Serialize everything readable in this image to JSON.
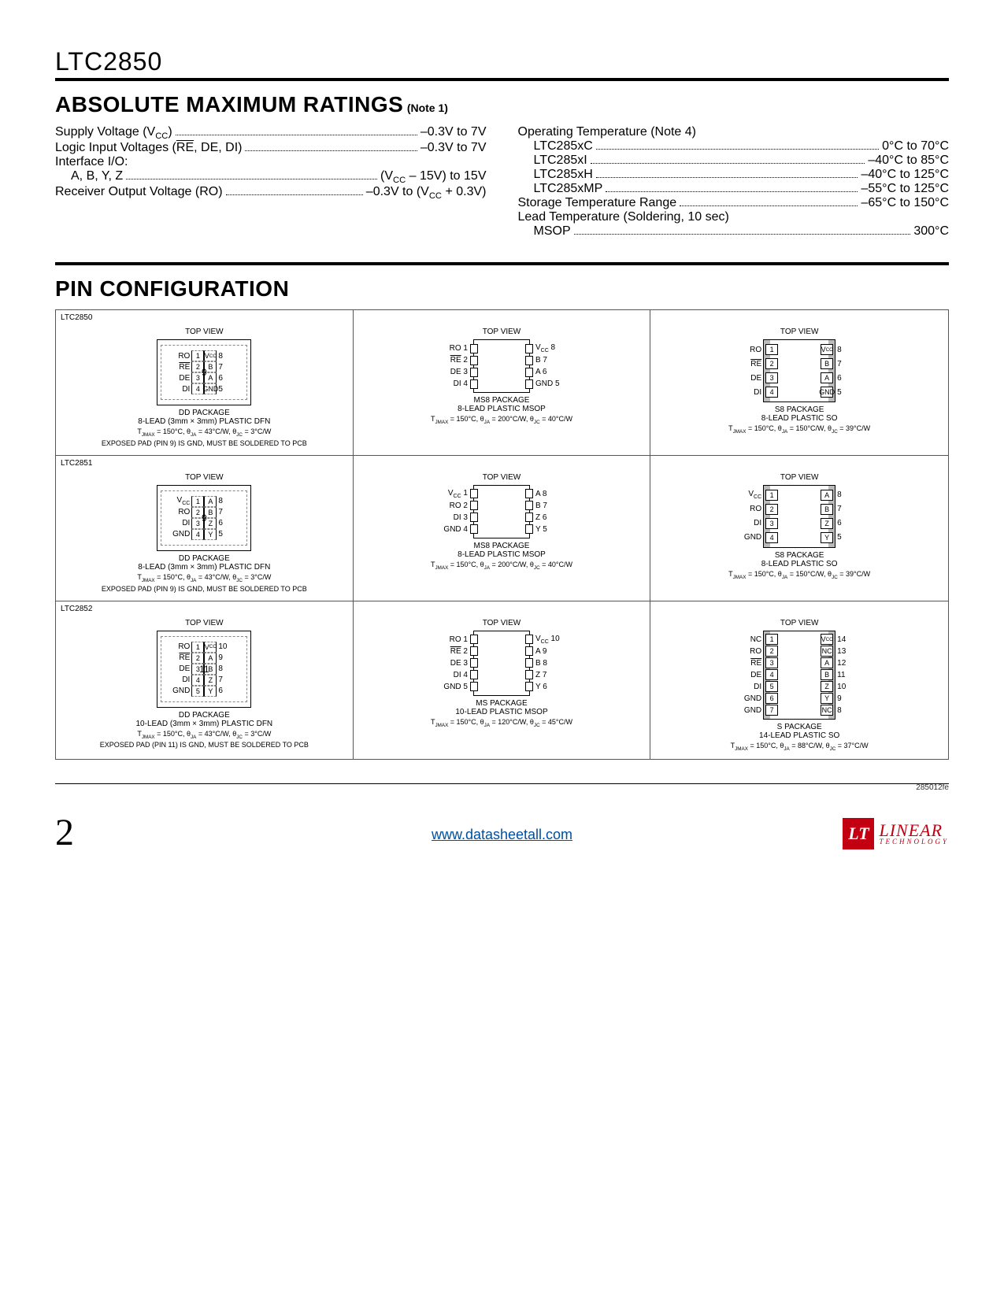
{
  "part_number": "LTC2850",
  "section1": {
    "title": "ABSOLUTE MAXIMUM RATINGS",
    "note": "(Note 1)"
  },
  "ratings_left": [
    {
      "label": "Supply Voltage (V<sub>CC</sub>)",
      "val": "–0.3V to 7V",
      "indent": 0
    },
    {
      "label": "Logic Input Voltages (<span class='overline'>RE</span>, DE, DI)",
      "val": "–0.3V to 7V",
      "indent": 0
    },
    {
      "label": "Interface I/O:",
      "val": "",
      "indent": 0,
      "nodots": true
    },
    {
      "label": "A, B, Y, Z",
      "val": "(V<sub>CC</sub> – 15V) to 15V",
      "indent": 1
    },
    {
      "label": "Receiver Output Voltage (RO)",
      "val": "–0.3V to (V<sub>CC</sub> + 0.3V)",
      "indent": 0
    }
  ],
  "ratings_right": [
    {
      "label": "Operating Temperature (Note 4)",
      "val": "",
      "indent": 0,
      "nodots": true
    },
    {
      "label": "LTC285xC",
      "val": "0°C to 70°C",
      "indent": 1
    },
    {
      "label": "LTC285xI",
      "val": "–40°C to 85°C",
      "indent": 1
    },
    {
      "label": "LTC285xH",
      "val": "–40°C to 125°C",
      "indent": 1
    },
    {
      "label": "LTC285xMP",
      "val": "–55°C to 125°C",
      "indent": 1
    },
    {
      "label": "Storage Temperature Range",
      "val": "–65°C to 150°C",
      "indent": 0
    },
    {
      "label": "Lead Temperature (Soldering, 10 sec)",
      "val": "",
      "indent": 0,
      "nodots": true
    },
    {
      "label": "MSOP",
      "val": "300°C",
      "indent": 1
    }
  ],
  "section2": {
    "title": "PIN CONFIGURATION"
  },
  "packages": [
    {
      "chip": "LTC2850",
      "cells": [
        {
          "type": "dfn",
          "center": "9",
          "left": [
            [
              "RO",
              "1"
            ],
            [
              "RE",
              "2",
              "ol"
            ],
            [
              "DE",
              "3"
            ],
            [
              "DI",
              "4"
            ]
          ],
          "right": [
            [
              "8",
              "V<sub>CC</sub>"
            ],
            [
              "7",
              "B"
            ],
            [
              "6",
              "A"
            ],
            [
              "5",
              "GND"
            ]
          ],
          "pkg": "DD PACKAGE",
          "sub": "8-LEAD (3mm × 3mm) PLASTIC DFN",
          "thermal": "T<sub>JMAX</sub> = 150°C, θ<sub>JA</sub> = 43°C/W, θ<sub>JC</sub> = 3°C/W",
          "note": "EXPOSED PAD (PIN 9) IS GND, MUST BE SOLDERED TO PCB"
        },
        {
          "type": "msop",
          "left": [
            [
              "RO",
              "1"
            ],
            [
              "RE",
              "2",
              "ol"
            ],
            [
              "DE",
              "3"
            ],
            [
              "DI",
              "4"
            ]
          ],
          "right": [
            [
              "8",
              "V<sub>CC</sub>"
            ],
            [
              "7",
              "B"
            ],
            [
              "6",
              "A"
            ],
            [
              "5",
              "GND"
            ]
          ],
          "pkg": "MS8 PACKAGE",
          "sub": "8-LEAD PLASTIC MSOP",
          "thermal": "T<sub>JMAX</sub> = 150°C, θ<sub>JA</sub> = 200°C/W, θ<sub>JC</sub> = 40°C/W"
        },
        {
          "type": "so",
          "left": [
            [
              "RO",
              "1"
            ],
            [
              "RE",
              "2",
              "ol"
            ],
            [
              "DE",
              "3"
            ],
            [
              "DI",
              "4"
            ]
          ],
          "right": [
            [
              "8",
              "V<sub>CC</sub>"
            ],
            [
              "7",
              "B"
            ],
            [
              "6",
              "A"
            ],
            [
              "5",
              "GND"
            ]
          ],
          "pkg": "S8 PACKAGE",
          "sub": "8-LEAD PLASTIC SO",
          "thermal": "T<sub>JMAX</sub> = 150°C, θ<sub>JA</sub> = 150°C/W, θ<sub>JC</sub> = 39°C/W"
        }
      ]
    },
    {
      "chip": "LTC2851",
      "cells": [
        {
          "type": "dfn",
          "center": "9",
          "left": [
            [
              "V<sub>CC</sub>",
              "1"
            ],
            [
              "RO",
              "2"
            ],
            [
              "DI",
              "3"
            ],
            [
              "GND",
              "4"
            ]
          ],
          "right": [
            [
              "8",
              "A"
            ],
            [
              "7",
              "B"
            ],
            [
              "6",
              "Z"
            ],
            [
              "5",
              "Y"
            ]
          ],
          "pkg": "DD PACKAGE",
          "sub": "8-LEAD (3mm × 3mm) PLASTIC DFN",
          "thermal": "T<sub>JMAX</sub> = 150°C, θ<sub>JA</sub> = 43°C/W, θ<sub>JC</sub> = 3°C/W",
          "note": "EXPOSED PAD (PIN 9) IS GND, MUST BE SOLDERED TO PCB"
        },
        {
          "type": "msop",
          "left": [
            [
              "V<sub>CC</sub>",
              "1"
            ],
            [
              "RO",
              "2"
            ],
            [
              "DI",
              "3"
            ],
            [
              "GND",
              "4"
            ]
          ],
          "right": [
            [
              "8",
              "A"
            ],
            [
              "7",
              "B"
            ],
            [
              "6",
              "Z"
            ],
            [
              "5",
              "Y"
            ]
          ],
          "pkg": "MS8 PACKAGE",
          "sub": "8-LEAD PLASTIC MSOP",
          "thermal": "T<sub>JMAX</sub> = 150°C, θ<sub>JA</sub> = 200°C/W, θ<sub>JC</sub> = 40°C/W"
        },
        {
          "type": "so",
          "left": [
            [
              "V<sub>CC</sub>",
              "1"
            ],
            [
              "RO",
              "2"
            ],
            [
              "DI",
              "3"
            ],
            [
              "GND",
              "4"
            ]
          ],
          "right": [
            [
              "8",
              "A"
            ],
            [
              "7",
              "B"
            ],
            [
              "6",
              "Z"
            ],
            [
              "5",
              "Y"
            ]
          ],
          "pkg": "S8 PACKAGE",
          "sub": "8-LEAD PLASTIC SO",
          "thermal": "T<sub>JMAX</sub> = 150°C, θ<sub>JA</sub> = 150°C/W, θ<sub>JC</sub> = 39°C/W"
        }
      ]
    },
    {
      "chip": "LTC2852",
      "cells": [
        {
          "type": "dfn",
          "center": "11",
          "left": [
            [
              "RO",
              "1"
            ],
            [
              "RE",
              "2",
              "ol"
            ],
            [
              "DE",
              "3"
            ],
            [
              "DI",
              "4"
            ],
            [
              "GND",
              "5"
            ]
          ],
          "right": [
            [
              "10",
              "V<sub>CC</sub>"
            ],
            [
              "9",
              "A"
            ],
            [
              "8",
              "B"
            ],
            [
              "7",
              "Z"
            ],
            [
              "6",
              "Y"
            ]
          ],
          "pkg": "DD PACKAGE",
          "sub": "10-LEAD (3mm × 3mm) PLASTIC DFN",
          "thermal": "T<sub>JMAX</sub> = 150°C, θ<sub>JA</sub> = 43°C/W, θ<sub>JC</sub> = 3°C/W",
          "note": "EXPOSED PAD (PIN 11) IS GND, MUST BE SOLDERED TO PCB"
        },
        {
          "type": "msop",
          "left": [
            [
              "RO",
              "1"
            ],
            [
              "RE",
              "2",
              "ol"
            ],
            [
              "DE",
              "3"
            ],
            [
              "DI",
              "4"
            ],
            [
              "GND",
              "5"
            ]
          ],
          "right": [
            [
              "10",
              "V<sub>CC</sub>"
            ],
            [
              "9",
              "A"
            ],
            [
              "8",
              "B"
            ],
            [
              "7",
              "Z"
            ],
            [
              "6",
              "Y"
            ]
          ],
          "pkg": "MS PACKAGE",
          "sub": "10-LEAD PLASTIC MSOP",
          "thermal": "T<sub>JMAX</sub> = 150°C, θ<sub>JA</sub> = 120°C/W, θ<sub>JC</sub> = 45°C/W"
        },
        {
          "type": "so",
          "left": [
            [
              "NC",
              "1"
            ],
            [
              "RO",
              "2"
            ],
            [
              "RE",
              "3",
              "ol"
            ],
            [
              "DE",
              "4"
            ],
            [
              "DI",
              "5"
            ],
            [
              "GND",
              "6"
            ],
            [
              "GND",
              "7"
            ]
          ],
          "right": [
            [
              "14",
              "V<sub>CC</sub>"
            ],
            [
              "13",
              "NC"
            ],
            [
              "12",
              "A"
            ],
            [
              "11",
              "B"
            ],
            [
              "10",
              "Z"
            ],
            [
              "9",
              "Y"
            ],
            [
              "8",
              "NC"
            ]
          ],
          "pkg": "S PACKAGE",
          "sub": "14-LEAD PLASTIC SO",
          "thermal": "T<sub>JMAX</sub> = 150°C, θ<sub>JA</sub> = 88°C/W, θ<sub>JC</sub> = 37°C/W"
        }
      ]
    }
  ],
  "topview": "TOP VIEW",
  "footer": {
    "doccode": "285012fe",
    "page": "2",
    "url": "www.datasheetall.com",
    "logo_mark": "LT",
    "logo_text": "LINEAR",
    "logo_sub": "TECHNOLOGY"
  }
}
